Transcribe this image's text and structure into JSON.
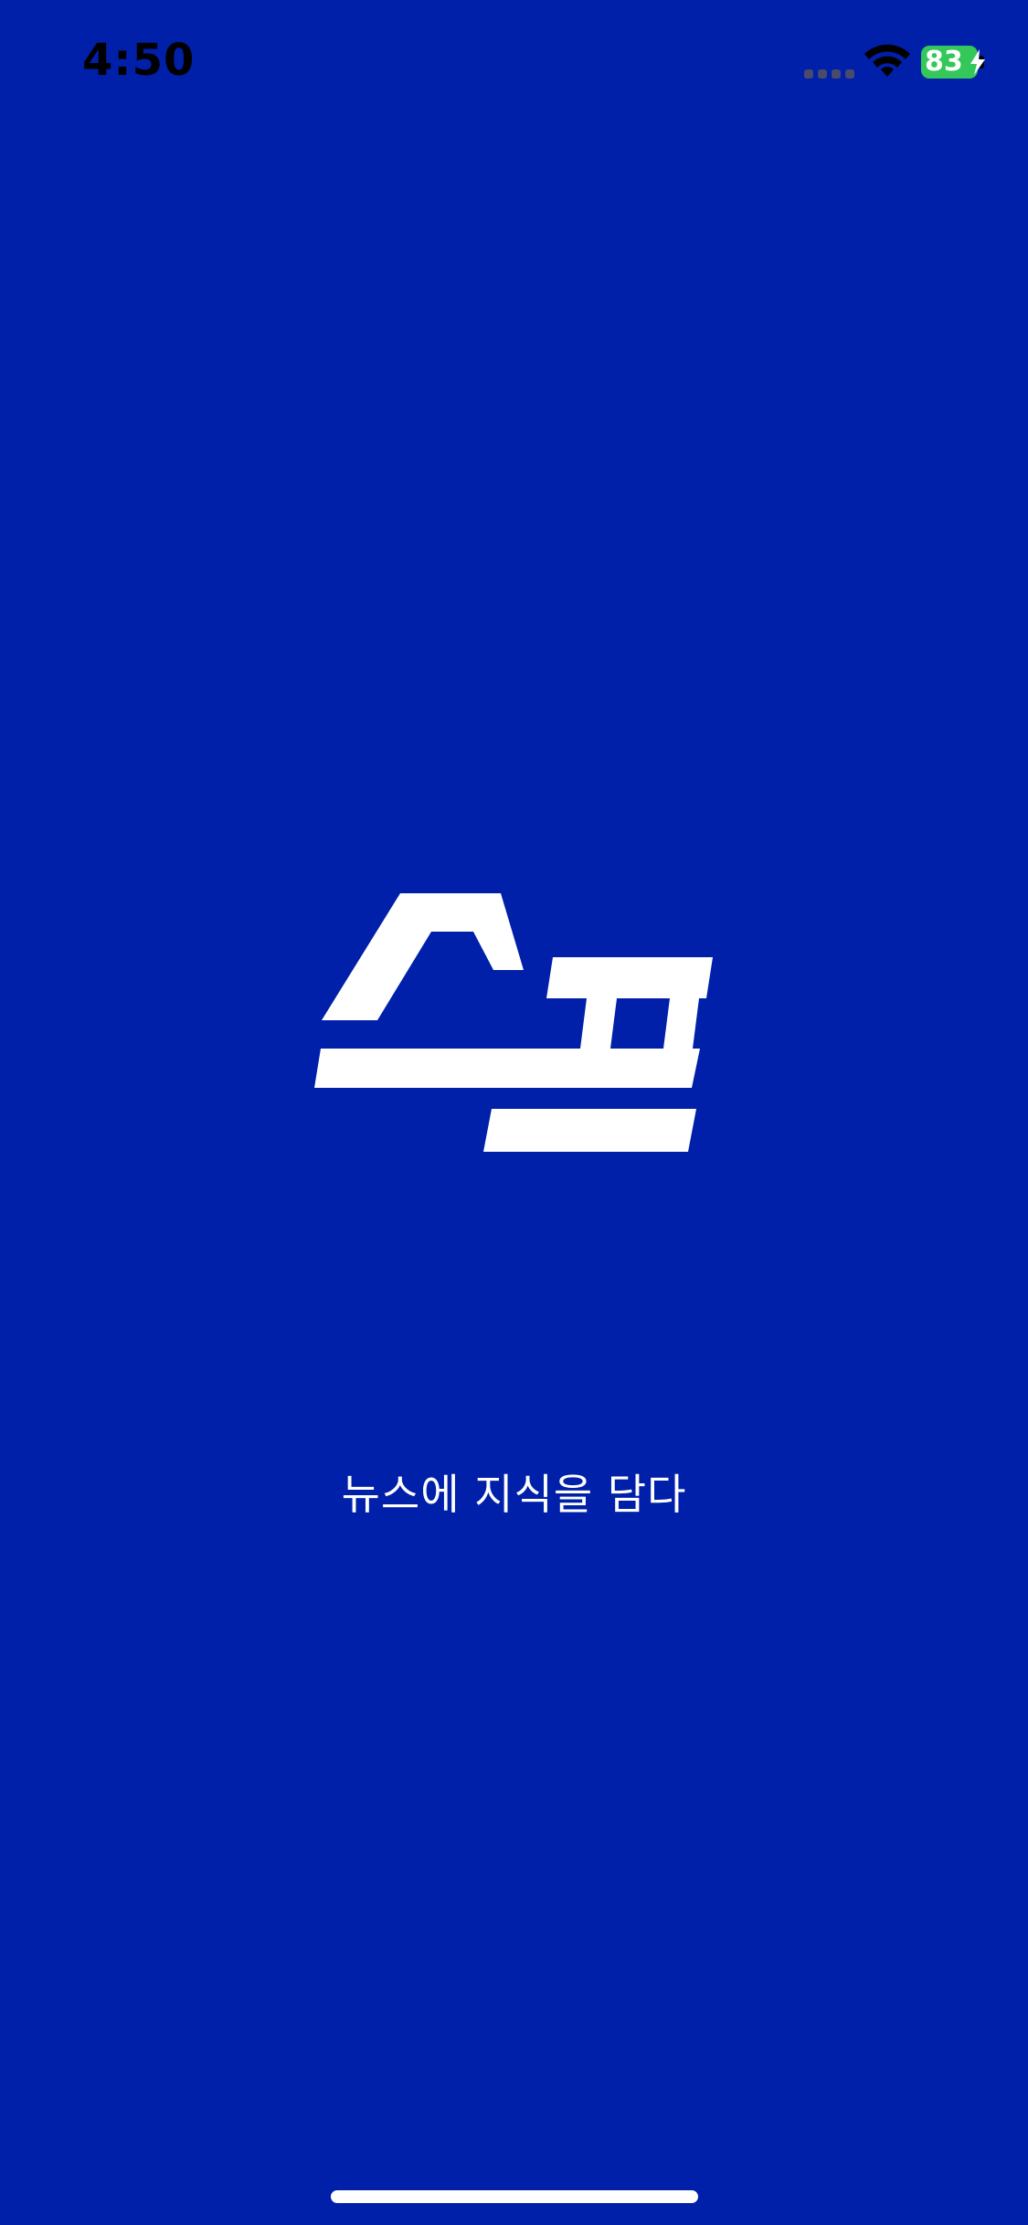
{
  "status_bar": {
    "time": "4:50",
    "battery_level": "83",
    "charging": true,
    "icons": [
      "signal-icon",
      "wifi-icon",
      "battery-icon",
      "charging-bolt-icon"
    ]
  },
  "splash": {
    "logo_icon": "spo-logo-icon",
    "tagline": "뉴스에 지식을 담다"
  },
  "colors": {
    "background": "#0020AA",
    "logo": "#FFFFFF",
    "battery": "#34C759",
    "status_text": "#000000"
  }
}
